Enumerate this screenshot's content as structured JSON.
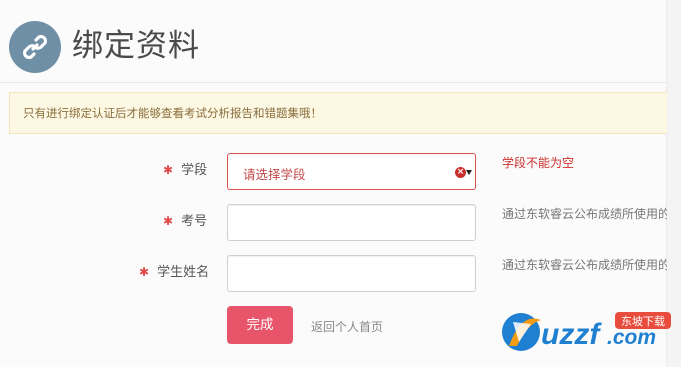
{
  "header": {
    "title": "绑定资料",
    "icon": "link-icon",
    "icon_bg_color": "#6f8fa6"
  },
  "notice": {
    "text": "只有进行绑定认证后才能够查看考试分析报告和错题集哦！"
  },
  "form": {
    "stage": {
      "label": "学段",
      "required": true,
      "placeholder": "请选择学段",
      "error": "学段不能为空"
    },
    "exam_no": {
      "label": "考号",
      "required": true,
      "value": "",
      "help": "通过东软睿云公布成绩所使用的"
    },
    "student_name": {
      "label": "学生姓名",
      "required": true,
      "value": "",
      "help": "通过东软睿云公布成绩所使用的"
    },
    "submit_label": "完成",
    "back_label": "返回个人首页"
  },
  "watermark": {
    "brand": "uzzf.com",
    "badge": "东坡下载"
  },
  "colors": {
    "accent": "#e8556b",
    "error": "#c9302c",
    "notice_bg": "#fcf8e3",
    "notice_text": "#8a6d3b"
  }
}
